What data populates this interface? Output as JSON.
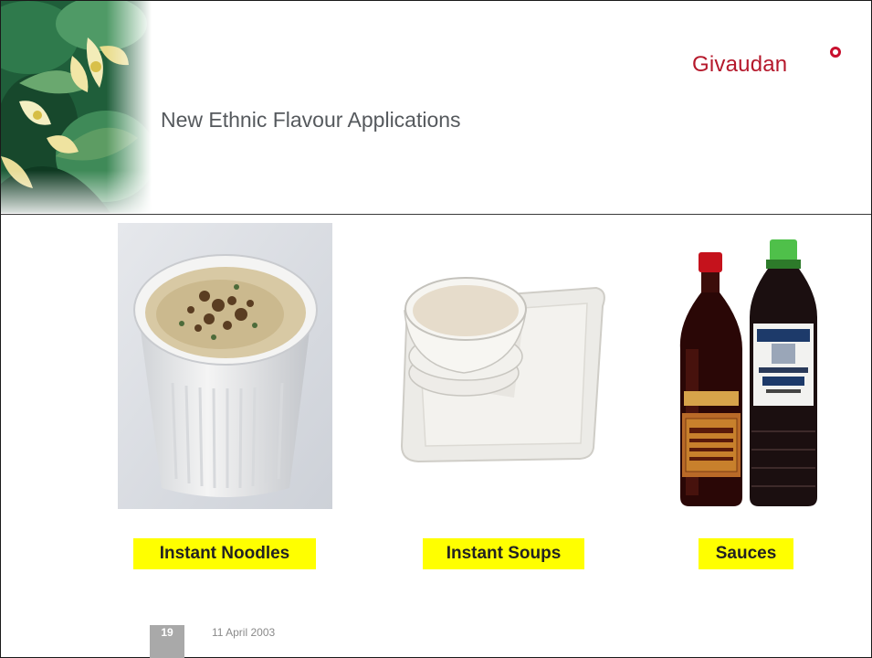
{
  "brand": {
    "name": "Givaudan"
  },
  "slide": {
    "title": "New Ethnic Flavour Applications"
  },
  "products": [
    {
      "label": "Instant Noodles"
    },
    {
      "label": "Instant Soups"
    },
    {
      "label": "Sauces"
    }
  ],
  "footer": {
    "page_number": "19",
    "date": "11 April 2003"
  },
  "colors": {
    "highlight": "#ffff00",
    "brand": "#b5182b",
    "title_text": "#55595d",
    "footer_box": "#a9a9a9"
  }
}
